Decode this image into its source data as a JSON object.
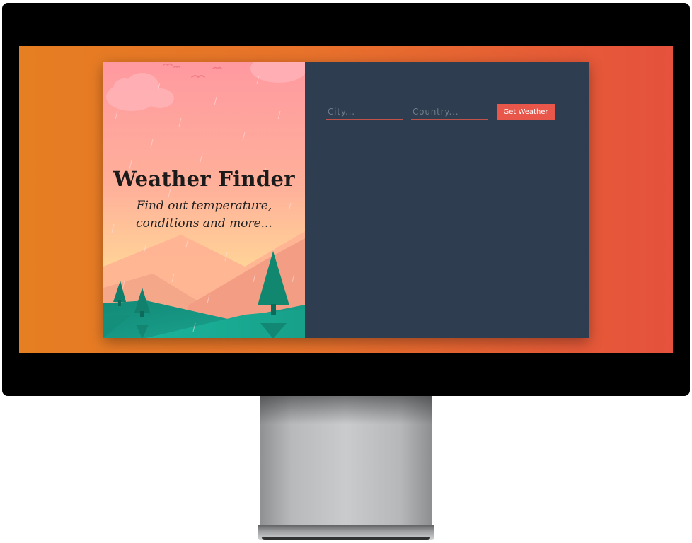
{
  "app": {
    "title": "Weather Finder",
    "subtitle_line1": "Find out temperature,",
    "subtitle_line2": "conditions and more..."
  },
  "form": {
    "city_placeholder": "City...",
    "city_value": "",
    "country_placeholder": "Country...",
    "country_value": "",
    "submit_label": "Get Weather"
  },
  "colors": {
    "screen_gradient_start": "#e67e22",
    "screen_gradient_end": "#e5513d",
    "panel_background": "#2e3e50",
    "button_background": "#e8574a",
    "sky_top": "#ff9aa2",
    "sky_bottom": "#ffd89b",
    "ground": "#16a085"
  },
  "illustration": {
    "icons": [
      "cloud-icon",
      "bird-icon",
      "mountain-icon",
      "tree-icon",
      "rain-icon"
    ]
  }
}
